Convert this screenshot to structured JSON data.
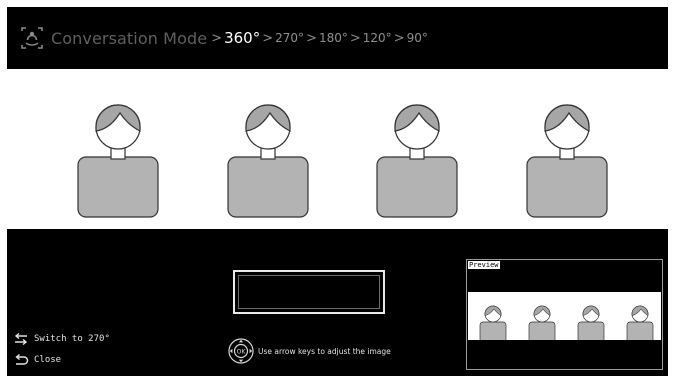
{
  "header": {
    "title": "Conversation Mode",
    "separator": ">",
    "angles": [
      {
        "label": "360°",
        "active": true
      },
      {
        "label": "270°",
        "active": false
      },
      {
        "label": "180°",
        "active": false
      },
      {
        "label": "120°",
        "active": false
      },
      {
        "label": "90°",
        "active": false
      }
    ]
  },
  "controls": {
    "switch_label": "Switch to 270°",
    "close_label": "Close",
    "ok_label": "OK",
    "adjust_hint": "Use arrow keys to adjust the image"
  },
  "preview": {
    "label": "Preview"
  },
  "scene": {
    "person_count": 4
  },
  "colors": {
    "background": "#000000",
    "scene": "#ffffff",
    "body_fill": "#b3b3b3",
    "hair_fill": "#a6a6a6",
    "active_text": "#ffffff",
    "inactive_text": "#8f8f8f"
  }
}
